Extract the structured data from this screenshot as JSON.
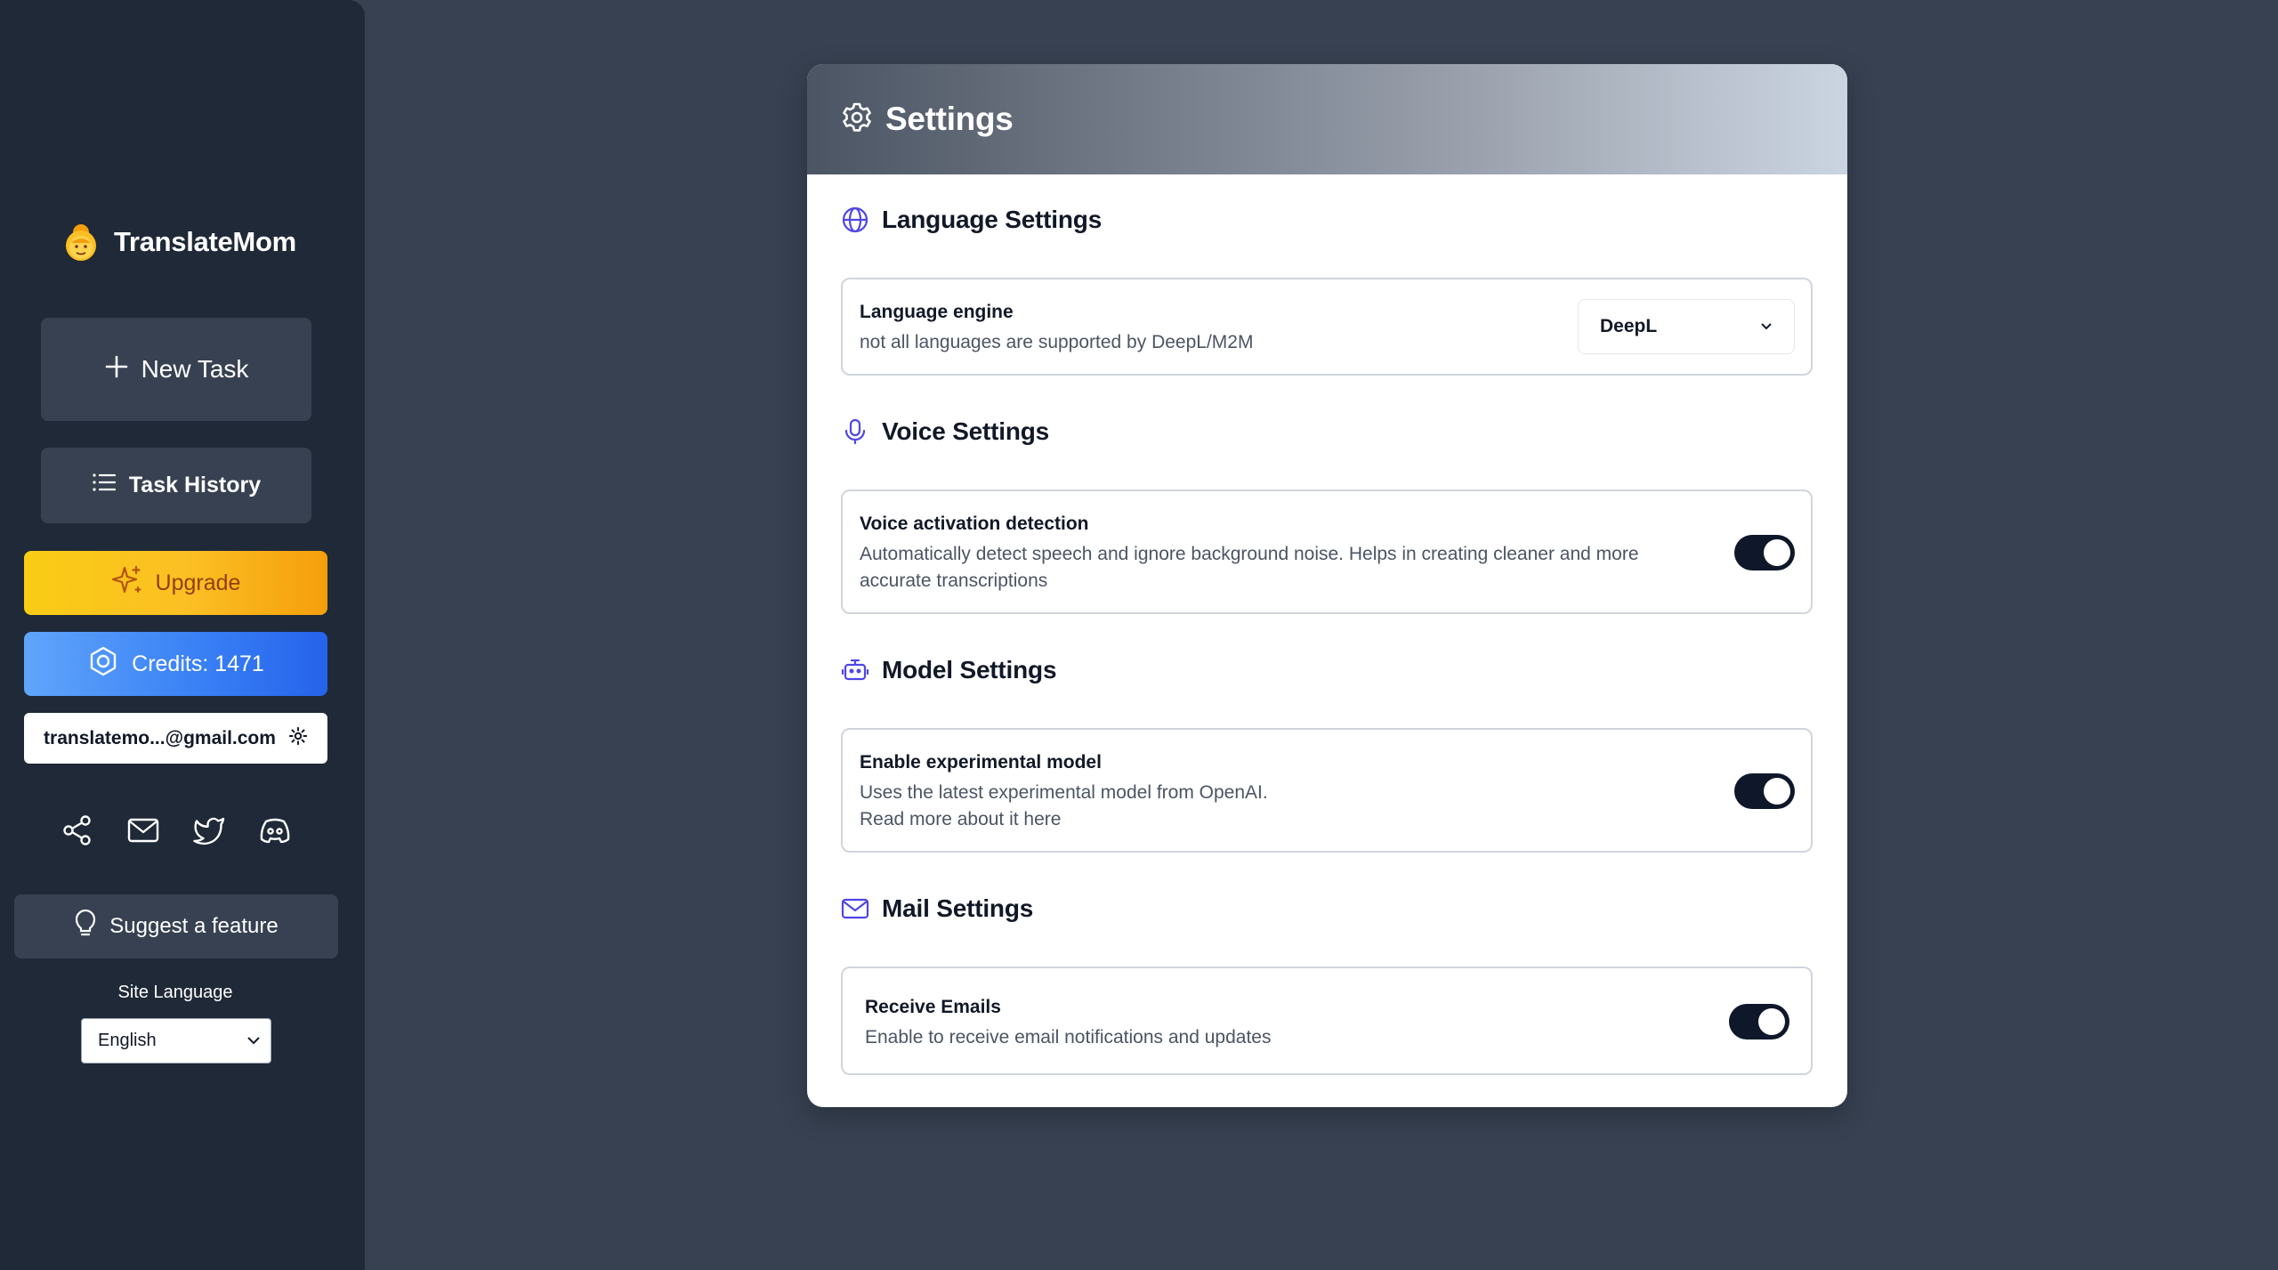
{
  "sidebar": {
    "app_name": "TranslateMom",
    "new_task": "New Task",
    "task_history": "Task History",
    "upgrade": "Upgrade",
    "credits": "Credits: 1471",
    "email": "translatemo...@gmail.com",
    "suggest": "Suggest a feature",
    "site_language_label": "Site Language",
    "site_language_value": "English",
    "social_icons": [
      "share-icon",
      "mail-icon",
      "twitter-icon",
      "discord-icon"
    ]
  },
  "settings": {
    "title": "Settings",
    "language": {
      "title": "Language Settings",
      "engine_label": "Language engine",
      "engine_desc": "not all languages are supported by DeepL/M2M",
      "engine_value": "DeepL"
    },
    "voice": {
      "title": "Voice Settings",
      "vad_label": "Voice activation detection",
      "vad_desc_line1": "Automatically detect speech and ignore background noise. Helps in creating cleaner and more",
      "vad_desc_line2": "accurate transcriptions",
      "vad_enabled": true
    },
    "model": {
      "title": "Model Settings",
      "exp_label": "Enable experimental model",
      "exp_desc_line1": "Uses the latest experimental model from OpenAI.",
      "exp_desc_line2": "Read more about it here",
      "exp_enabled": true
    },
    "mail": {
      "title": "Mail Settings",
      "receive_label": "Receive Emails",
      "receive_desc": "Enable to receive email notifications and updates",
      "receive_enabled": true
    }
  },
  "colors": {
    "page_bg": "#374151",
    "sidebar_bg": "#1f2937",
    "accent_icon": "#4f46e5",
    "upgrade_text": "#92400e",
    "toggle_on": "#0f172a"
  }
}
